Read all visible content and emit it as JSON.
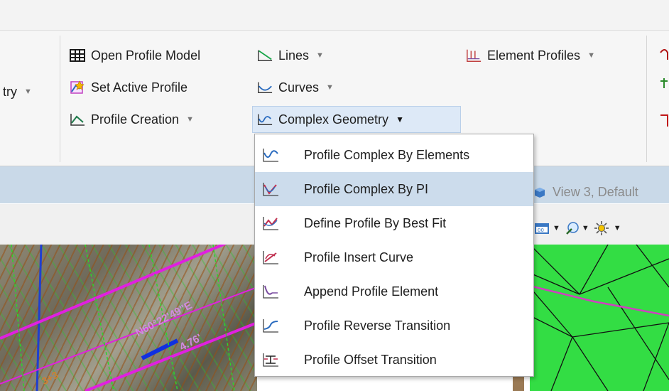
{
  "ribbon": {
    "left_partial": {
      "label": "try"
    },
    "col1": [
      {
        "label": "Open Profile Model",
        "icon": "grid-table-icon"
      },
      {
        "label": "Set Active Profile",
        "icon": "set-active-profile-icon"
      },
      {
        "label": "Profile Creation",
        "icon": "profile-creation-icon"
      }
    ],
    "col2": [
      {
        "label": "Lines",
        "icon": "line-icon"
      },
      {
        "label": "Curves",
        "icon": "curve-icon"
      },
      {
        "label": "Complex Geometry",
        "icon": "complex-geometry-icon"
      }
    ],
    "element_profiles": {
      "label": "Element Profiles",
      "icon": "element-profiles-icon"
    }
  },
  "view": {
    "title": "View 3, Default"
  },
  "dropdown": {
    "items": [
      {
        "label": "Profile Complex By Elements",
        "icon": "profile-complex-elements-icon"
      },
      {
        "label": "Profile Complex By PI",
        "icon": "profile-complex-pi-icon",
        "highlighted": true
      },
      {
        "label": "Define Profile By Best Fit",
        "icon": "best-fit-icon"
      },
      {
        "label": "Profile Insert Curve",
        "icon": "insert-curve-icon"
      },
      {
        "label": "Append Profile Element",
        "icon": "append-element-icon"
      },
      {
        "label": "Profile Reverse Transition",
        "icon": "reverse-transition-icon"
      },
      {
        "label": "Profile Offset Transition",
        "icon": "offset-transition-icon"
      }
    ]
  },
  "map": {
    "bearing_text": "N60°22'49\"E",
    "distance_text": "4.76'",
    "station_text": "3+3"
  },
  "colors": {
    "highlight": "#ccdcec",
    "profile_icon": "#2a6bbf",
    "accent_magenta": "#e020e0"
  }
}
